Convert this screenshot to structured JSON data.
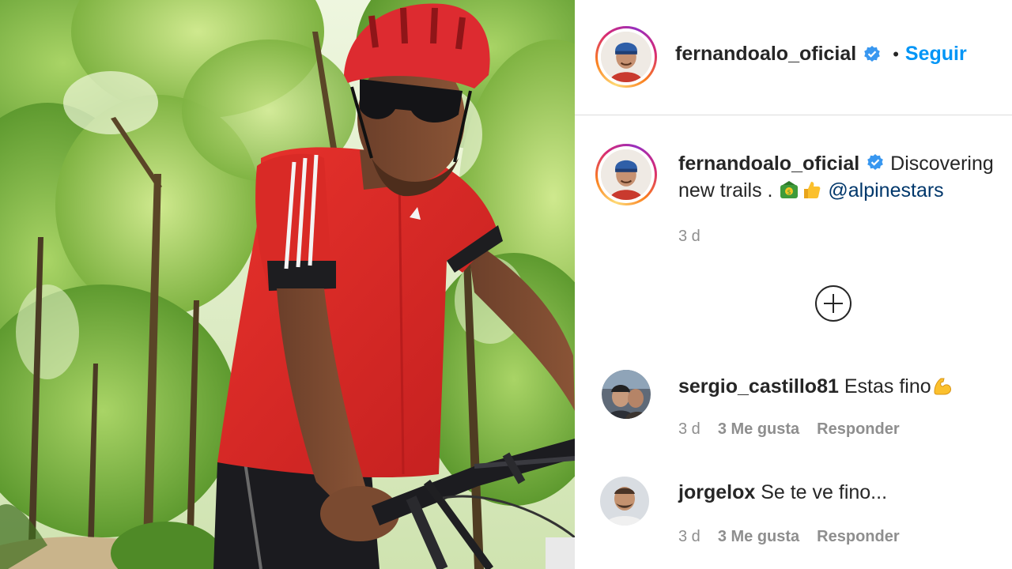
{
  "post": {
    "photo_alt": "Cyclist in a red jersey and red helmet on a mountain bike in a forest",
    "author": {
      "username": "fernandoalo_oficial",
      "follow_label": "Seguir",
      "separator": "•"
    },
    "caption": {
      "username": "fernandoalo_oficial",
      "text": "Discovering new trails . ",
      "emojis": [
        "money-bag-emoji",
        "thumbs-up-emoji"
      ],
      "mention": "@alpinestars",
      "time": "3 d"
    },
    "comments": [
      {
        "username": "sergio_castillo81",
        "text": "Estas fino",
        "emoji": "flexed-biceps-emoji",
        "time": "3 d",
        "likes": "3 Me gusta",
        "reply": "Responder"
      },
      {
        "username": "jorgelox",
        "text": "Se te ve fino...",
        "time": "3 d",
        "likes": "3 Me gusta",
        "reply": "Responder"
      }
    ]
  },
  "colors": {
    "follow_blue": "#0095f6",
    "mention_blue": "#00376b",
    "muted_gray": "#8e8e8e",
    "text": "#262626",
    "verified_blue": "#3897f0"
  }
}
